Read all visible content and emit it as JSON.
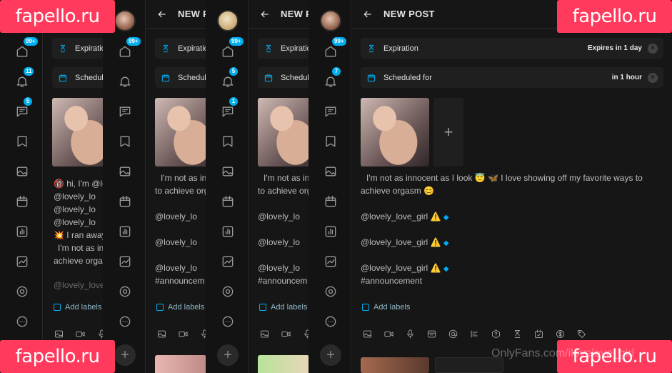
{
  "badges": {
    "home": "99+",
    "notif_a": "11",
    "notif_b": "5",
    "notif_c": "7",
    "msg_a": "5",
    "msg_b": "1"
  },
  "compose": {
    "title": "NEW POST",
    "expiration_label": "Expiration",
    "expiration_value": "Expires in 1 day",
    "scheduled_label": "Scheduled for",
    "scheduled_value": "in 1 hour",
    "add_labels": "Add labels",
    "add_media": "+",
    "caption": "I'm not as innocent as I look 😇 🦋 I love showing off my favorite ways to achieve orgasm 😊",
    "mention": "@lovely_love_girl",
    "mention_icon": "⚠️",
    "hashtag": "#announcement",
    "partial_caption_1": "I'm not as in",
    "partial_caption_2": "to achieve orgs",
    "partial_caption_3": "achieve orgas",
    "partial_mention": "@lovely_lo",
    "partial_hashtag": "#announcem",
    "partial_exp": "Expiration",
    "partial_sched": "Schedule",
    "partial_title": "NEW PO",
    "left_intro": "🔞 hi, I'm @lo",
    "left_ran": "💥 I ran away",
    "left_tail": "@lovely_love"
  },
  "watermarks": {
    "brand": "fapello.ru",
    "onlyfans": "OnlyFans.com/ilovelove_girl"
  },
  "colors": {
    "accent": "#00aff0",
    "watermark": "#ff3a5c",
    "background": "#151515"
  },
  "icons": [
    "home-icon",
    "bell-icon",
    "chat-icon",
    "bookmark-icon",
    "image-icon",
    "calendar-icon",
    "stats-icon",
    "chart-icon",
    "profile-icon",
    "more-icon",
    "hourglass-icon",
    "clock-calendar-icon",
    "mic-icon",
    "video-icon",
    "gif-icon",
    "at-icon",
    "align-icon",
    "question-icon",
    "dollar-icon",
    "tag-icon",
    "back-arrow-icon"
  ]
}
